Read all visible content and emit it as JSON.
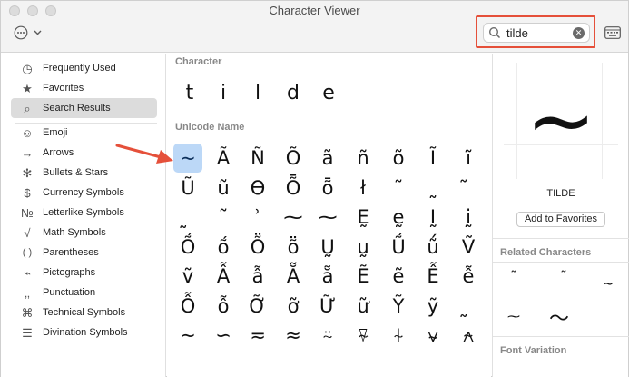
{
  "window": {
    "title": "Character Viewer"
  },
  "toolbar": {
    "action_icon": "ellipsis-circle-icon",
    "chevron_icon": "chevron-down-icon",
    "search_value": "tilde",
    "search_icon": "magnifying-glass-icon",
    "clear_icon": "clear-circle-icon",
    "clear_glyph": "✕",
    "panel_icon": "keyboard-panel-icon"
  },
  "colors": {
    "highlight": "#e5503a",
    "selection": "#bcd8f7",
    "arrow": "#e5503a"
  },
  "sidebar": {
    "items": [
      {
        "label": "Frequently Used",
        "icon": "clock-icon",
        "glyph": "◷"
      },
      {
        "label": "Favorites",
        "icon": "star-icon",
        "glyph": "★"
      },
      {
        "label": "Search Results",
        "icon": "search-icon",
        "glyph": "⌕"
      },
      {
        "label": "Emoji",
        "icon": "smiley-icon",
        "glyph": "☺"
      },
      {
        "label": "Arrows",
        "icon": "arrow-right-icon",
        "glyph": "→"
      },
      {
        "label": "Bullets & Stars",
        "icon": "asterisk-icon",
        "glyph": "✻"
      },
      {
        "label": "Currency Symbols",
        "icon": "dollar-icon",
        "glyph": "$"
      },
      {
        "label": "Letterlike Symbols",
        "icon": "numero-icon",
        "glyph": "№"
      },
      {
        "label": "Math Symbols",
        "icon": "square-root-icon",
        "glyph": "√"
      },
      {
        "label": "Parentheses",
        "icon": "parentheses-icon",
        "glyph": "( )"
      },
      {
        "label": "Pictographs",
        "icon": "pictograph-icon",
        "glyph": "⌁"
      },
      {
        "label": "Punctuation",
        "icon": "punctuation-icon",
        "glyph": "‚‚"
      },
      {
        "label": "Technical Symbols",
        "icon": "command-icon",
        "glyph": "⌘"
      },
      {
        "label": "Divination Symbols",
        "icon": "trigram-icon",
        "glyph": "☰"
      }
    ]
  },
  "main": {
    "character_heading": "Character",
    "characters": [
      "t",
      "i",
      "l",
      "d",
      "e"
    ],
    "unicode_heading": "Unicode Name",
    "grid": [
      "~",
      "Ã",
      "Ñ",
      "Õ",
      "ã",
      "ñ",
      "õ",
      "Ĩ",
      "ĩ",
      "Ũ",
      "ũ",
      "ϴ",
      "Ȭ",
      "ȭ",
      "ł",
      "˜",
      "˷",
      "̃",
      "̰",
      "˜",
      "ʾ",
      "⁓",
      "⁓",
      "Ḛ",
      "ḛ",
      "Ḭ",
      "ḭ",
      "Ṍ",
      "ṍ",
      "Ṏ",
      "ṏ",
      "Ṵ",
      "ṵ",
      "Ṹ",
      "ṹ",
      "Ṽ",
      "ṽ",
      "Ẫ",
      "ẫ",
      "Ẵ",
      "ẵ",
      "Ẽ",
      "ẽ",
      "Ễ",
      "ễ",
      "Ỗ",
      "ỗ",
      "Ỡ",
      "ỡ",
      "Ữ",
      "ữ",
      "Ỹ",
      "ỹ",
      "̰",
      "∼",
      "∽",
      "≂",
      "≈",
      "⍨",
      "⍫",
      "⍭",
      "⍱",
      "⍲"
    ]
  },
  "detail": {
    "preview_glyph": "~",
    "name": "TILDE",
    "add_favorites_label": "Add to Favorites",
    "related_heading": "Related Characters",
    "related": [
      "˜",
      "˜",
      "~",
      "⁓",
      "〜"
    ],
    "font_variation_heading": "Font Variation"
  }
}
